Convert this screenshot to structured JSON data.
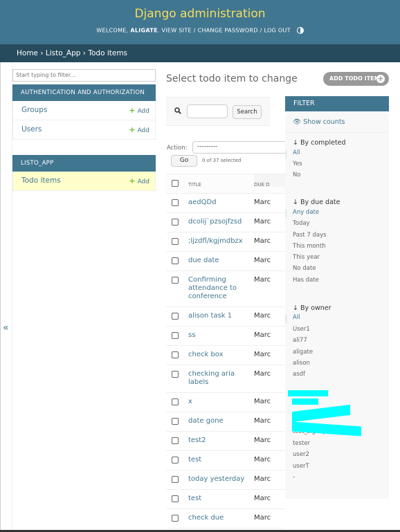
{
  "header": {
    "site_title": "Django administration",
    "welcome": "Welcome,",
    "username": "aligate",
    "view_site": "View site",
    "change_password": "Change password",
    "log_out": "Log out"
  },
  "breadcrumbs": {
    "home": "Home",
    "app": "Listo_App",
    "current": "Todo items",
    "sep": "›"
  },
  "sidebar": {
    "filter_placeholder": "Start typing to filter...",
    "toggle_glyph": "«",
    "apps": [
      {
        "caption": "Authentication and Authorization",
        "models": [
          {
            "name": "Groups",
            "add": "Add"
          },
          {
            "name": "Users",
            "add": "Add"
          }
        ]
      },
      {
        "caption": "Listo_App",
        "models": [
          {
            "name": "Todo items",
            "add": "Add"
          }
        ]
      }
    ]
  },
  "main": {
    "title": "Select todo item to change",
    "add_button": "Add todo item",
    "search_button": "Search",
    "action_label": "Action:",
    "action_value": "---------",
    "go_button": "Go",
    "selected_count": "0 of 37 selected",
    "columns": {
      "title": "Title",
      "due": "Due d"
    },
    "rows": [
      {
        "title": "aedQDd",
        "due": "Marc"
      },
      {
        "title": "dcolij`pzsojfzsd",
        "due": "Marc"
      },
      {
        "title": ";ljzdfl/kgjmdbzx",
        "due": "Marc"
      },
      {
        "title": "due date",
        "due": "Marc"
      },
      {
        "title": "Confirming attendance to conference",
        "due": "Marc"
      },
      {
        "title": "alison task 1",
        "due": "Marc"
      },
      {
        "title": "ss",
        "due": "Marc"
      },
      {
        "title": "check box",
        "due": "Marc"
      },
      {
        "title": "checking aria labels",
        "due": "Marc"
      },
      {
        "title": "x",
        "due": "Marc"
      },
      {
        "title": "date gone",
        "due": "Marc"
      },
      {
        "title": "test2",
        "due": "Marc"
      },
      {
        "title": "test",
        "due": "Marc"
      },
      {
        "title": "today yesterday",
        "due": "Marc"
      },
      {
        "title": "test",
        "due": "Marc"
      },
      {
        "title": "check due",
        "due": "Marc"
      }
    ]
  },
  "filter": {
    "heading": "Filter",
    "show_counts": "Show counts",
    "by_completed": {
      "title": "↓ By completed",
      "options": [
        "All",
        "Yes",
        "No"
      ]
    },
    "by_due_date": {
      "title": "↓ By due date",
      "options": [
        "Any date",
        "Today",
        "Past 7 days",
        "This month",
        "This year",
        "No date",
        "Has date"
      ]
    },
    "by_owner": {
      "title": "↓ By owner",
      "options": [
        "All",
        "User1",
        "ali77",
        "aligate",
        "alison",
        "asdf",
        "test_signup",
        "tester",
        "user2",
        "userT",
        "-"
      ]
    }
  },
  "colors": {
    "header": "#417690",
    "breadcrumbs": "#264b5d",
    "site_title": "#f5dd5d",
    "link": "#417690",
    "add_plus": "#70bf2b",
    "current_row": "#ffffcc",
    "redaction": "#00ffff"
  }
}
